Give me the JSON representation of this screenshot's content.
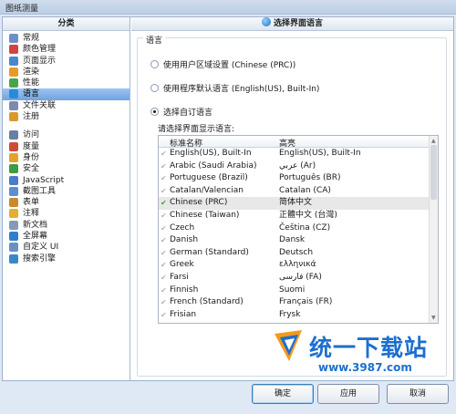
{
  "window": {
    "title": "图纸测量"
  },
  "left_panel": {
    "header": "分类",
    "groups": [
      [
        {
          "label": "常规",
          "icon": "general-icon",
          "color": "#6c8fc7"
        },
        {
          "label": "颜色管理",
          "icon": "color-management-icon",
          "color": "#d1443f"
        },
        {
          "label": "页面显示",
          "icon": "page-display-icon",
          "color": "#4c86c9"
        },
        {
          "label": "渲染",
          "icon": "render-icon",
          "color": "#e59b2a"
        },
        {
          "label": "性能",
          "icon": "performance-icon",
          "color": "#4aa54a"
        },
        {
          "label": "语言",
          "icon": "language-globe-icon",
          "color": "#2a8ad8",
          "selected": true
        },
        {
          "label": "文件关联",
          "icon": "file-association-icon",
          "color": "#7c8ca8"
        },
        {
          "label": "注册",
          "icon": "register-icon",
          "color": "#d79b2b"
        }
      ],
      [
        {
          "label": "访问",
          "icon": "access-icon",
          "color": "#6b7f9f"
        },
        {
          "label": "度量",
          "icon": "measure-icon",
          "color": "#d14a3a"
        },
        {
          "label": "身份",
          "icon": "identity-icon",
          "color": "#e2a22f"
        },
        {
          "label": "安全",
          "icon": "security-icon",
          "color": "#3d9c45"
        },
        {
          "label": "JavaScript",
          "icon": "javascript-icon",
          "color": "#4d7bc5"
        },
        {
          "label": "截图工具",
          "icon": "screenshot-tool-icon",
          "color": "#5b8fd0"
        },
        {
          "label": "表单",
          "icon": "form-icon",
          "color": "#c98a2f"
        },
        {
          "label": "注释",
          "icon": "comment-icon",
          "color": "#e0b12f"
        },
        {
          "label": "新文档",
          "icon": "new-document-icon",
          "color": "#8799b5"
        },
        {
          "label": "全屏幕",
          "icon": "fullscreen-icon",
          "color": "#2f7fcf"
        },
        {
          "label": "自定义 UI",
          "icon": "custom-ui-icon",
          "color": "#6d8fbd"
        },
        {
          "label": "搜索引擎",
          "icon": "search-engine-icon",
          "color": "#3a86c8"
        }
      ]
    ]
  },
  "right_panel": {
    "header": "选择界面语言",
    "group_title": "语言",
    "options": [
      {
        "label": "使用用户区域设置 (Chinese (PRC))",
        "checked": false
      },
      {
        "label": "使用程序默认语言 (English(US), Built-In)",
        "checked": false
      },
      {
        "label": "选择自订语言",
        "checked": true
      }
    ],
    "list_hint": "请选择界面显示语言:",
    "list": {
      "col1": "标准名称",
      "col2": "高亮",
      "rows": [
        [
          "English(US), Built-In",
          "English(US), Built-In"
        ],
        [
          "Arabic (Saudi Arabia)",
          "عربي (Ar)"
        ],
        [
          "Portuguese (Brazil)",
          "Português (BR)"
        ],
        [
          "Catalan/Valencian",
          "Catalan (CA)"
        ],
        [
          "Chinese (PRC)",
          "简体中文"
        ],
        [
          "Chinese (Taiwan)",
          "正體中文 (台灣)"
        ],
        [
          "Czech",
          "Čeština (CZ)"
        ],
        [
          "Danish",
          "Dansk"
        ],
        [
          "German (Standard)",
          "Deutsch"
        ],
        [
          "Greek",
          "ελληνικά"
        ],
        [
          "Farsi",
          "فارسی (FA)"
        ],
        [
          "Finnish",
          "Suomi"
        ],
        [
          "French (Standard)",
          "Français (FR)"
        ],
        [
          "Frisian",
          "Frysk"
        ]
      ],
      "selected_index": 4
    }
  },
  "watermark": {
    "title": "统一下载站",
    "url": "www.3987.com"
  },
  "buttons": {
    "ok": "确定",
    "apply": "应用",
    "cancel": "取消"
  }
}
